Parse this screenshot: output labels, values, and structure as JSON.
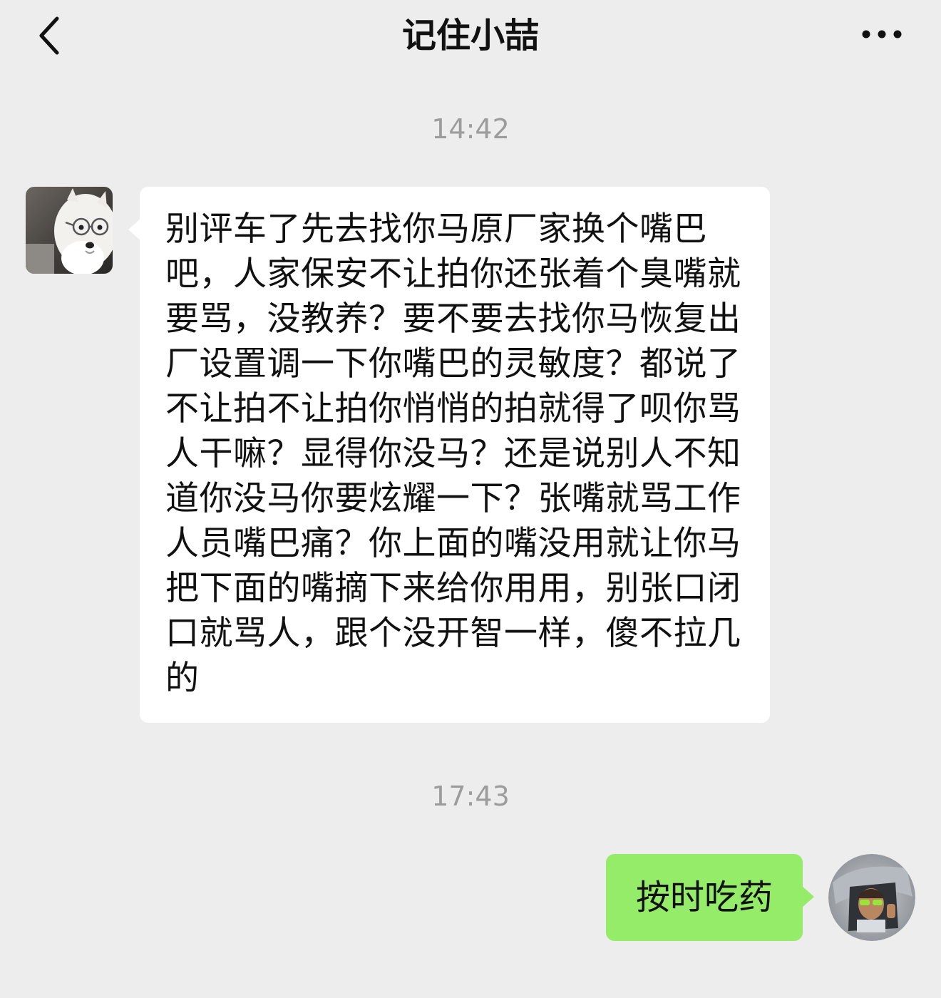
{
  "header": {
    "title": "记住小喆",
    "back_icon": "chevron-left-icon",
    "more_icon": "more-dots-icon"
  },
  "messages": [
    {
      "time": "14:42",
      "direction": "incoming",
      "text": "别评车了先去找你马原厂家换个嘴巴吧，人家保安不让拍你还张着个臭嘴就要骂，没教养？要不要去找你马恢复出厂设置调一下你嘴巴的灵敏度？都说了不让拍不让拍你悄悄的拍就得了呗你骂人干嘛？显得你没马？还是说别人不知道你没马你要炫耀一下？张嘴就骂工作人员嘴巴痛？你上面的嘴没用就让你马把下面的嘴摘下来给你用用，别张口闭口就骂人，跟个没开智一样，傻不拉几的"
    },
    {
      "time": "17:43",
      "direction": "outgoing",
      "text": "按时吃药"
    }
  ],
  "colors": {
    "background": "#ededed",
    "incoming_bubble": "#ffffff",
    "outgoing_bubble": "#95ec69",
    "timestamp": "#9c9c9c"
  }
}
